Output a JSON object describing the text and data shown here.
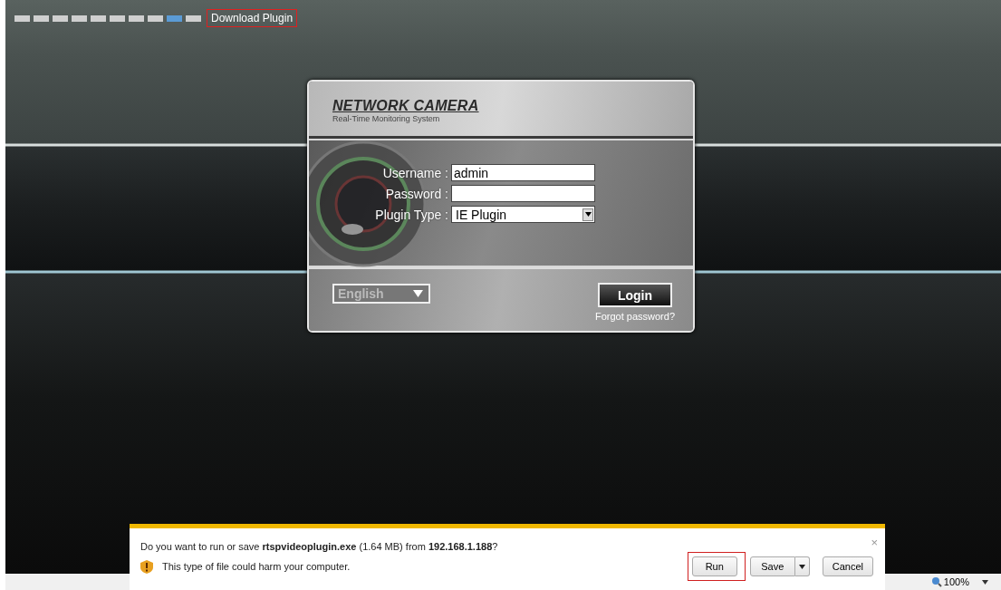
{
  "nav": {
    "blocks": [
      {
        "selected": false
      },
      {
        "selected": false
      },
      {
        "selected": false
      },
      {
        "selected": false
      },
      {
        "selected": false
      },
      {
        "selected": false
      },
      {
        "selected": false
      },
      {
        "selected": false
      },
      {
        "selected": true
      },
      {
        "selected": false
      }
    ],
    "download_link": {
      "label": "Download Plugin",
      "highlighted": true
    }
  },
  "login": {
    "brand": "NETWORK CAMERA",
    "tagline": "Real-Time Monitoring System",
    "fields": [
      {
        "kind": "text",
        "label": "Username :",
        "value": "admin"
      },
      {
        "kind": "password",
        "label": "Password :"
      },
      {
        "kind": "select",
        "label": "Plugin Type :",
        "value": "IE Plugin"
      }
    ],
    "language": "English",
    "login_button": "Login",
    "forgot_link": "Forgot password?"
  },
  "download_bar": {
    "message": "Do you want to run or save **rtspvideoplugin.exe** (1.64 MB) from **192.168.1.188**?",
    "warning": "This type of file could harm your computer.",
    "close": "×",
    "buttons": [
      {
        "kind": "button",
        "label": "Run",
        "highlighted": true
      },
      {
        "kind": "split",
        "label": "Save",
        "highlighted": false
      },
      {
        "kind": "button",
        "label": "Cancel",
        "highlighted": false
      }
    ]
  },
  "status_bar": {
    "zoom": "100%"
  }
}
